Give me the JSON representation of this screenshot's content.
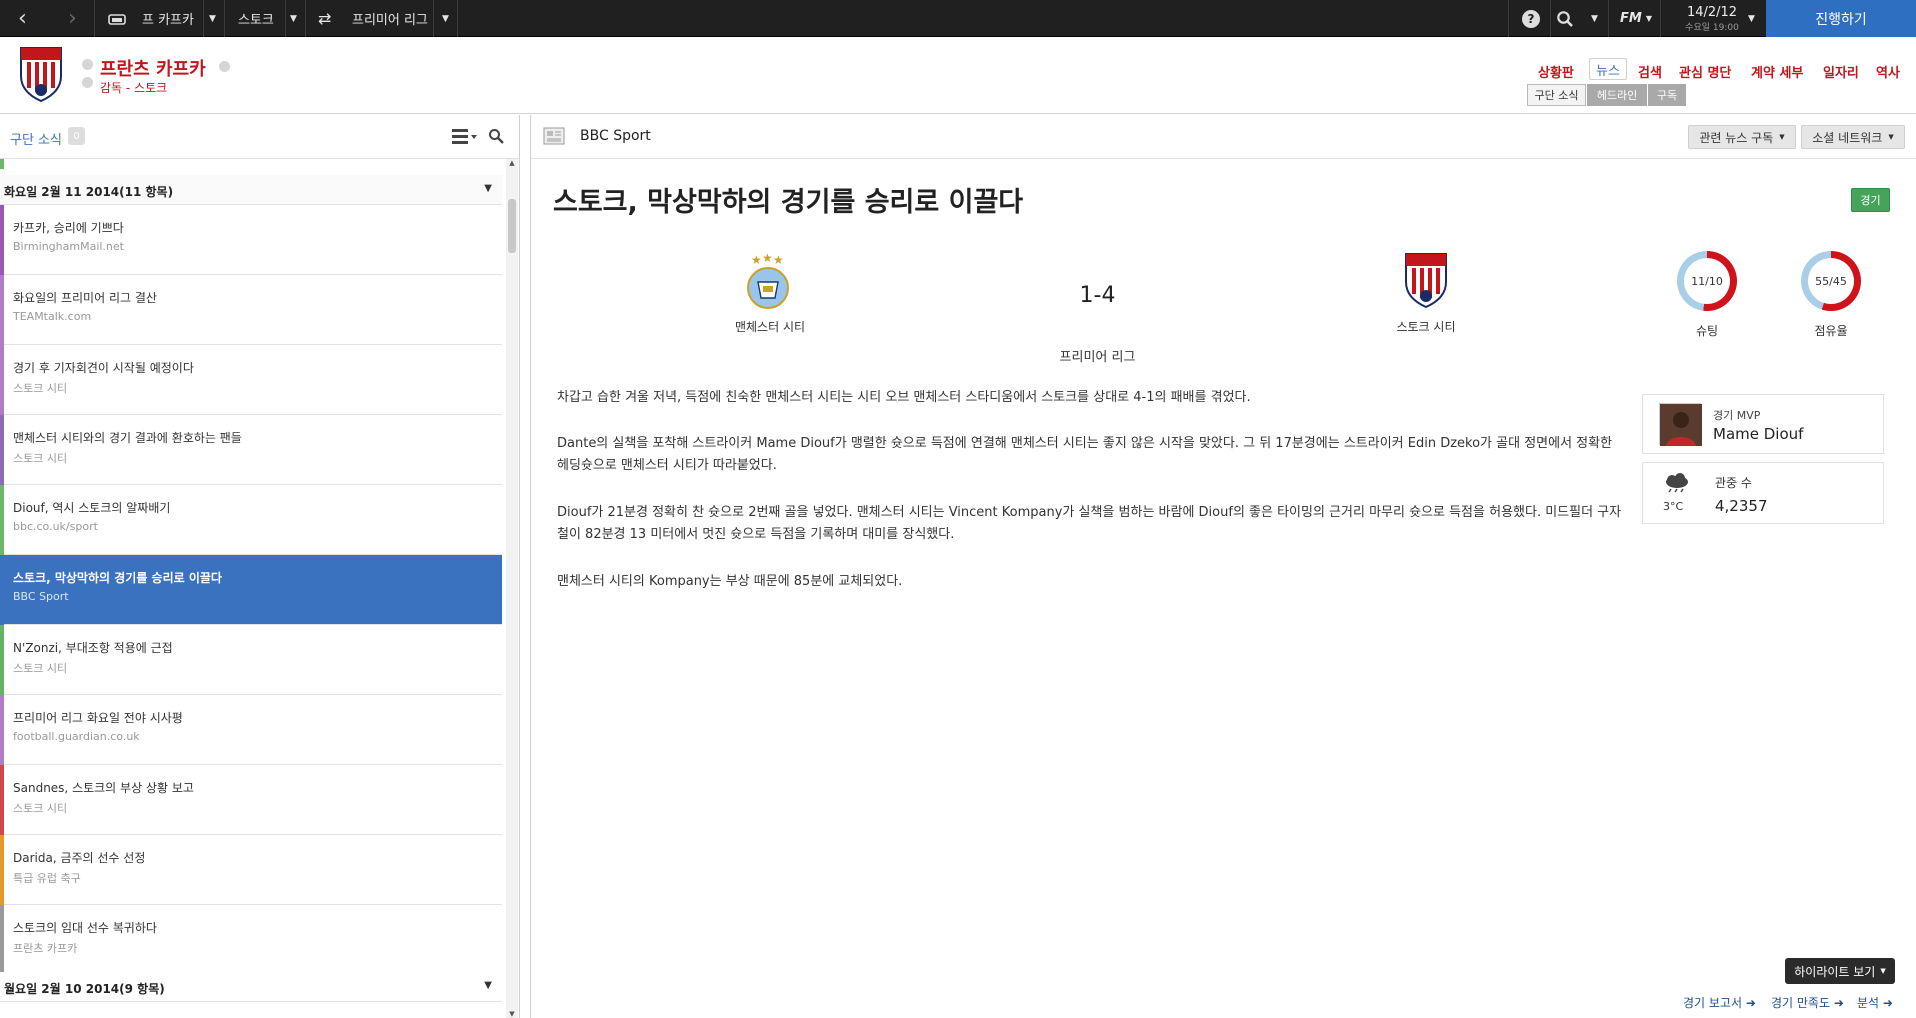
{
  "topbar": {
    "crumb1": "프 카프카",
    "crumb2": "스토크",
    "crumb3": "프리미어 리그",
    "date": "14/2/12",
    "weekday_time": "수요일 19:00",
    "fm_label": "FM",
    "continue_label": "진행하기"
  },
  "header": {
    "manager_name": "프란츠 카프카",
    "role": "감독 - 스토크",
    "nav": [
      "상황판",
      "뉴스",
      "검색",
      "관심 명단",
      "계약 세부",
      "일자리",
      "역사"
    ],
    "subtabs": [
      "구단 소식",
      "헤드라인",
      "구독"
    ]
  },
  "left": {
    "title": "구단 소식",
    "count": "0",
    "group1_label": "화요일 2월 11 2014(11 항목)",
    "group2_label": "월요일 2월 10 2014(9 항목)",
    "items": [
      {
        "title": "카프카, 승리에 기쁘다",
        "source": "BirminghamMail.net",
        "color": "#9b59b6"
      },
      {
        "title": "화요일의 프리미어 리그 결산",
        "source": "TEAMtalk.com",
        "color": "#b07cc6"
      },
      {
        "title": "경기 후 기자회견이 시작될 예정이다",
        "source": "스토크 시티",
        "color": "#b07cc6"
      },
      {
        "title": "맨체스터 시티와의 경기 결과에 환호하는 팬들",
        "source": "스토크 시티",
        "color": "#8e6bb8"
      },
      {
        "title": "Diouf, 역시 스토크의 알짜배기",
        "source": "bbc.co.uk/sport",
        "color": "#6bb86b"
      },
      {
        "title": "스토크, 막상막하의 경기를 승리로 이끌다",
        "source": "BBC Sport",
        "color": "#3b72c0"
      },
      {
        "title": "N'Zonzi, 부대조항 적용에 근접",
        "source": "스토크 시티",
        "color": "#66b366"
      },
      {
        "title": "프리미어 리그 화요일 전야 시사평",
        "source": "football.guardian.co.uk",
        "color": "#b07cc6"
      },
      {
        "title": "Sandnes, 스토크의 부상 상황 보고",
        "source": "스토크 시티",
        "color": "#d64545"
      },
      {
        "title": "Darida, 금주의 선수 선정",
        "source": "특급 유럽 축구",
        "color": "#e39a2b"
      },
      {
        "title": "스토크의 임대 선수 복귀하다",
        "source": "프란츠 카프카",
        "color": "#9a9a9a"
      }
    ]
  },
  "article": {
    "source": "BBC Sport",
    "subscribe_label": "관련 뉴스 구독",
    "social_label": "소셜 네트워크",
    "headline": "스토크, 막상막하의 경기를 승리로 이끌다",
    "badge": "경기",
    "home_team": "맨체스터 시티",
    "away_team": "스토크 시티",
    "score": "1-4",
    "competition": "프리미어 리그",
    "shots_value": "11/10",
    "shots_label": "슈팅",
    "possession_value": "55/45",
    "possession_label": "점유율",
    "paragraphs": [
      "차갑고 습한 겨울 저녁, 득점에 친숙한 맨체스터 시티는 시티 오브 맨체스터 스타디움에서 스토크를 상대로 4-1의 패배를 겪었다.",
      "Dante의 실책을 포착해 스트라이커 Mame Diouf가 맹렬한 슛으로 득점에 연결해 맨체스터 시티는 좋지 않은 시작을 맞았다. 그 뒤 17분경에는 스트라이커 Edin Dzeko가 골대 정면에서 정확한 헤딩슛으로 맨체스터 시티가 따라붙었다.",
      "Diouf가 21분경 정확히 찬 슛으로 2번째 골을 넣었다. 맨체스터 시티는 Vincent Kompany가 실책을 범하는 바람에 Diouf의 좋은 타이밍의 근거리 마무리 슛으로 득점을 허용했다. 미드필더 구자철이 82분경 13 미터에서 멋진 슛으로 득점을 기록하며 대미를 장식했다.",
      "맨체스터 시티의 Kompany는 부상 때문에 85분에 교체되었다."
    ],
    "mvp_label": "경기 MVP",
    "mvp_name": "Mame Diouf",
    "temperature": "3°C",
    "attendance_label": "관중 수",
    "attendance": "4,2357",
    "highlights_label": "하이라이트 보기",
    "footer_links": [
      "경기 보고서",
      "경기 만족도",
      "분석"
    ]
  },
  "colors": {
    "accent": "#c0161c",
    "selected": "#3b72c0",
    "continue": "#2f6fc2",
    "ring_red": "#d0121b",
    "ring_blue": "#a9cfe8"
  }
}
